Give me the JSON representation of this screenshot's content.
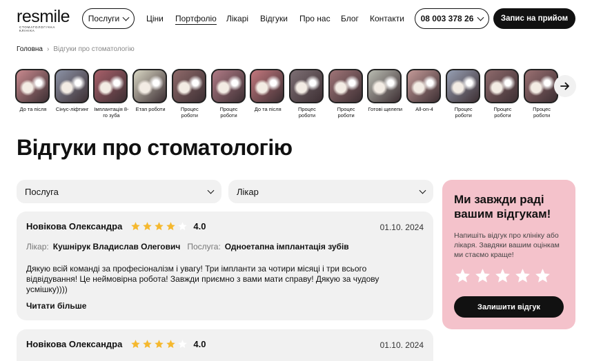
{
  "header": {
    "logo_text": "resmile",
    "logo_sub": "стоматологічна клініка",
    "services_label": "Послуги",
    "nav": [
      "Ціни",
      "Портфоліо",
      "Лікарі",
      "Відгуки",
      "Про нас",
      "Блог",
      "Контакти"
    ],
    "active_nav": "Портфоліо",
    "phone": "08 003 378 26",
    "cta_label": "Запис на прийом"
  },
  "breadcrumb": {
    "home": "Головна",
    "current": "Відгуки про стоматологію"
  },
  "thumbnails": [
    {
      "label": "До та після",
      "color": "#c98a8f"
    },
    {
      "label": "Сінус-ліфтинг",
      "color": "#8c93a6"
    },
    {
      "label": "Імплантація 8-го зуба",
      "color": "#a8606a"
    },
    {
      "label": "Етап роботи",
      "color": "#d9d7c4"
    },
    {
      "label": "Процес роботи",
      "color": "#8f6a6a"
    },
    {
      "label": "Процес роботи",
      "color": "#b07b86"
    },
    {
      "label": "До та після",
      "color": "#c4787e"
    },
    {
      "label": "Процес роботи",
      "color": "#7d6f74"
    },
    {
      "label": "Процес роботи",
      "color": "#a07578"
    },
    {
      "label": "Готові щелепи",
      "color": "#b9bcb2"
    },
    {
      "label": "All-on-4",
      "color": "#c49a98"
    },
    {
      "label": "Процес роботи",
      "color": "#97a0b4"
    },
    {
      "label": "Процес роботи",
      "color": "#8e6a6c"
    },
    {
      "label": "Процес роботи",
      "color": "#9a7072"
    }
  ],
  "page_title": "Відгуки про стоматологію",
  "filters": {
    "service_placeholder": "Послуга",
    "doctor_placeholder": "Лікар"
  },
  "reviews": [
    {
      "author": "Новікова Олександра",
      "rating": "4.0",
      "stars": 4,
      "date": "01.10. 2024",
      "doctor_label": "Лікар:",
      "doctor": "Кушнірук Владислав Олегович",
      "service_label": "Послуга:",
      "service": "Одноетапна імплантація зубів",
      "text": "Дякую всій команді за професіоналізм і увагу! Три імпланти за чотири місяці і три всього відвідування! Це неймовірна робота! Завжди приємно з вами мати справу! Дякую за чудову усмішку))))",
      "read_more": "Читати більше"
    },
    {
      "author": "Новікова Олександра",
      "rating": "4.0",
      "stars": 4,
      "date": "01.10. 2024"
    }
  ],
  "side": {
    "title": "Ми завжди раді вашим відгукам!",
    "text": "Напишіть відгук про клініку або лікаря. Завдяки вашим оцінкам ми стаємо краще!",
    "button": "Залишити відгук"
  },
  "colors": {
    "star_active": "#f5b82e",
    "star_inactive": "#ffffff",
    "pink": "#f4c2cb",
    "card_bg": "#f1f1f1",
    "dark": "#111111"
  }
}
